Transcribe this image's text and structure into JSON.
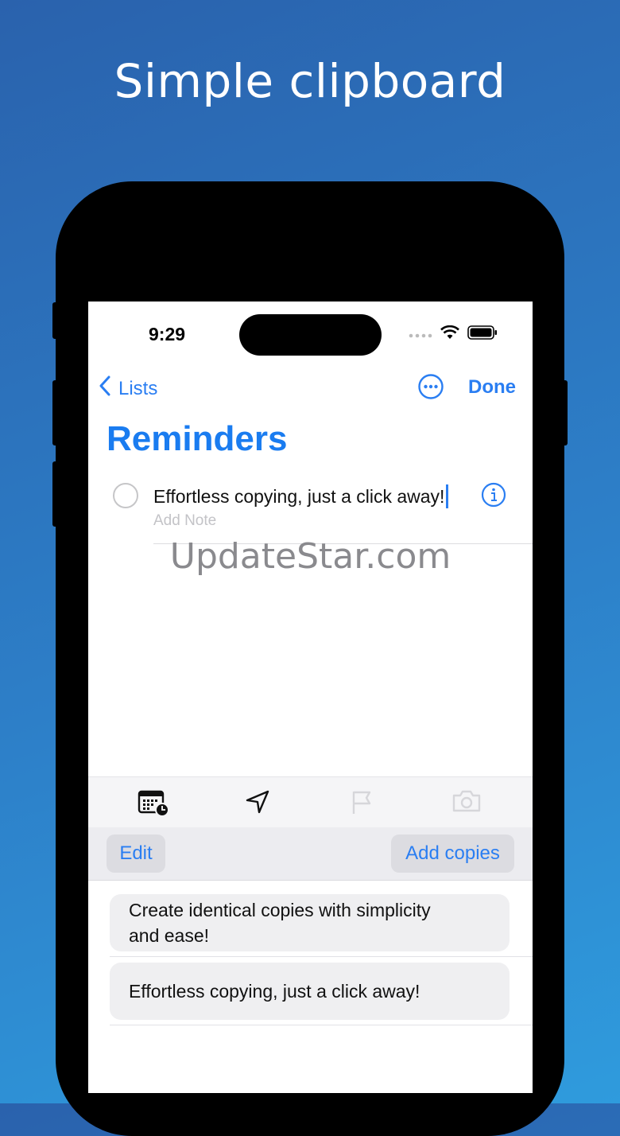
{
  "headline": "Simple clipboard",
  "status": {
    "time": "9:29"
  },
  "nav": {
    "back_label": "Lists",
    "done_label": "Done"
  },
  "list": {
    "title": "Reminders",
    "item_text": "Effortless copying, just a click away!",
    "note_placeholder": "Add Note"
  },
  "watermark": "UpdateStar.com",
  "toolbar_icons": [
    "calendar-clock-icon",
    "location-arrow-icon",
    "flag-icon",
    "camera-icon"
  ],
  "clip_bar": {
    "edit_label": "Edit",
    "add_label": "Add copies"
  },
  "clips": [
    {
      "text": "Create identical copies with simplicity and ease!"
    },
    {
      "text": "Effortless copying, just a click away!"
    }
  ],
  "colors": {
    "accent": "#2a7ef2",
    "title": "#1a7cf0",
    "background_top": "#2a62ad",
    "background_bottom": "#2f9bdd"
  }
}
